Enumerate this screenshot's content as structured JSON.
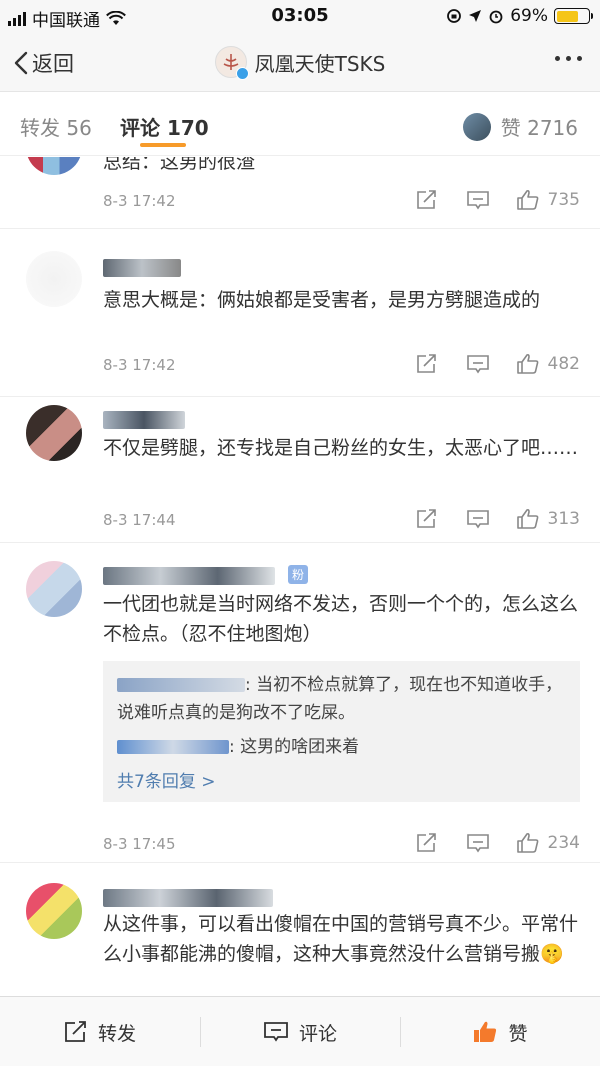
{
  "status_bar": {
    "carrier": "中国联通",
    "time": "03:05",
    "battery": "69%",
    "battery_level": 0.69
  },
  "navbar": {
    "back_label": "返回",
    "title": "凤凰天使TSKS"
  },
  "tabs": {
    "forward_label": "转发 56",
    "comment_label": "评论 170",
    "like_label": "赞 2716"
  },
  "comments": [
    {
      "text": "总结：这男的很渣",
      "time": "8-3 17:42",
      "likes": "735"
    },
    {
      "text": "意思大概是：俩姑娘都是受害者，是男方劈腿造成的",
      "time": "8-3 17:42",
      "likes": "482"
    },
    {
      "text": "不仅是劈腿，还专找是自己粉丝的女生，太恶心了吧……",
      "time": "8-3 17:44",
      "likes": "313"
    },
    {
      "text": "一代团也就是当时网络不发达，否则一个个的，怎么这么不检点。（忍不住地图炮）",
      "time": "8-3 17:45",
      "likes": "234",
      "badge": "粉",
      "replies": [
        {
          "text": ": 当初不检点就算了，现在也不知道收手，说难听点真的是狗改不了吃屎。"
        },
        {
          "text": ": 这男的啥团来着"
        }
      ],
      "more_replies": "共7条回复 >"
    },
    {
      "text": "从这件事，可以看出傻帽在中国的营销号真不少。平常什么小事都能沸的傻帽，这种大事竟然没什么营销号搬🤫"
    }
  ],
  "bottom_bar": {
    "forward_label": "转发",
    "comment_label": "评论",
    "like_label": "赞"
  },
  "colors": {
    "accent": "#f79b2a",
    "link": "#507daf",
    "muted": "#999999"
  }
}
